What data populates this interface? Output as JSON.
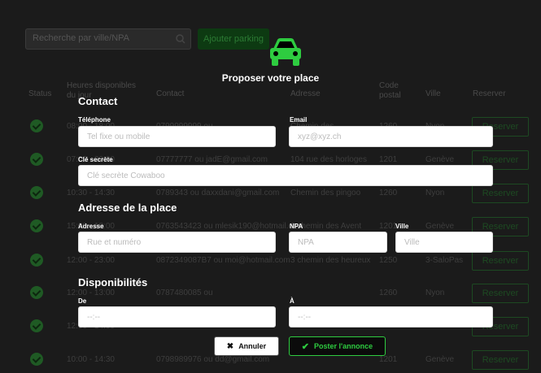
{
  "background": {
    "search_placeholder": "Recherche par ville/NPA",
    "add_button": "Ajouter parking",
    "headers": {
      "status": "Status",
      "hours": "Heures disponibles du jour",
      "contact": "Contact",
      "address": "Adresse",
      "postal": "Code postal",
      "city": "Ville",
      "reserve": "Reserver"
    },
    "rows": [
      {
        "hours": "08:00 - 18:00",
        "contact": "0799999999 ou",
        "address": "Chemin des",
        "postal": "1260",
        "city": "Nyon",
        "button": "Reserver"
      },
      {
        "hours": "07:00 - 20:00",
        "contact": "07777777 ou jadE@gmail.com",
        "address": "104 rue des horloges",
        "postal": "1201",
        "city": "Genève",
        "button": "Reserver"
      },
      {
        "hours": "10:30 - 14:30",
        "contact": "0789343 ou daxxdani@gmail.com",
        "address": "Chemin des pingoo",
        "postal": "1260",
        "city": "Nyon",
        "button": "Reserver"
      },
      {
        "hours": "15:00 - 18:00",
        "contact": "0763543423 ou mlesik190@hotmail.com",
        "address": "6 chemin des Avent",
        "postal": "1201",
        "city": "Genève",
        "button": "Reserver"
      },
      {
        "hours": "12:00 - 23:00",
        "contact": "0872349087B7 ou moi@hotmail.com",
        "address": "3 chemin des heureux",
        "postal": "1250",
        "city": "3-SaloPas",
        "button": "Reserver"
      },
      {
        "hours": "12:00 - 13:00",
        "contact": "0787480085 ou",
        "address": "",
        "postal": "1260",
        "city": "Nyon",
        "button": "Reserver"
      },
      {
        "hours": "12:00 - 14:00",
        "contact": "",
        "address": "",
        "postal": "",
        "city": "",
        "button": "Reserver"
      },
      {
        "hours": "10:00 - 14:30",
        "contact": "0798989976 ou dd@gmail.com",
        "address": "",
        "postal": "1201",
        "city": "Genève",
        "button": "Reserver"
      }
    ]
  },
  "modal": {
    "title": "Proposer votre place",
    "contact": {
      "title": "Contact",
      "phone_label": "Téléphone",
      "phone_placeholder": "Tel fixe ou mobile",
      "email_label": "Email",
      "email_placeholder": "xyz@xyz.ch",
      "secret_label": "Clé secrète",
      "secret_placeholder": "Clé secrète Cowaboo"
    },
    "address": {
      "title": "Adresse de la place",
      "street_label": "Adresse",
      "street_placeholder": "Rue et numéro",
      "npa_label": "NPA",
      "npa_placeholder": "NPA",
      "city_label": "Ville",
      "city_placeholder": "Ville"
    },
    "availability": {
      "title": "Disponibilités",
      "from_label": "De",
      "from_placeholder": "--:--",
      "to_label": "À",
      "to_placeholder": "--:--"
    },
    "cancel_button": "Annuler",
    "post_button": "Poster l'annonce"
  },
  "icons": {
    "car": "car-icon",
    "search": "search-icon",
    "status": "check-circle-icon",
    "cancel": "close-icon",
    "post": "checkmark-icon"
  },
  "colors": {
    "accent": "#2ecc40",
    "overlay": "#000000"
  }
}
